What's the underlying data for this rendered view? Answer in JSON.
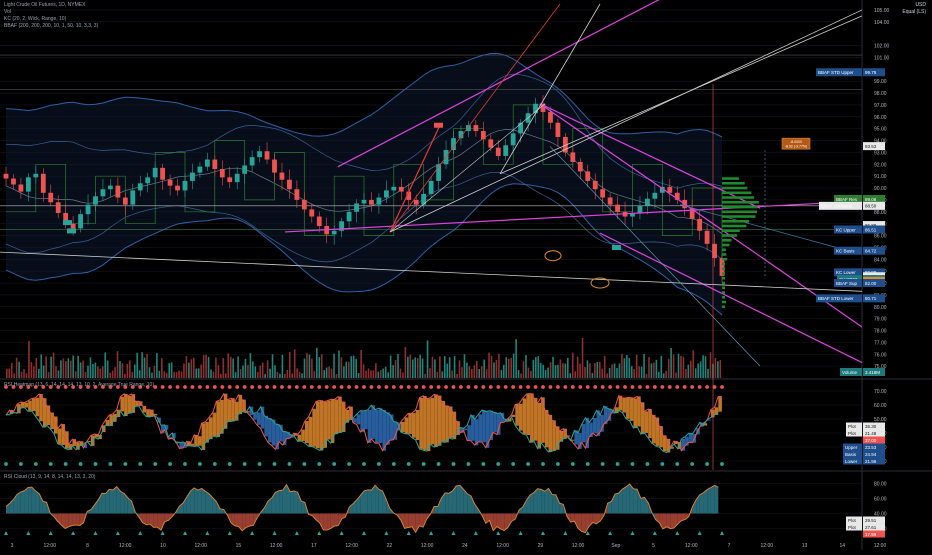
{
  "header": {
    "symbol_line": "Light Crude Oil Futures, 1D, NYMEX",
    "sub_line": "Vol",
    "ind1_line": "KC (20, 2, Wick, Range, 10)",
    "ind2_line": "BBAF (200, 200, 200, 10, 1, 50, 10, 3.3, 3)",
    "currency": "USD",
    "scale_mode": "Equal (LS)"
  },
  "colors": {
    "bg": "#000000",
    "up": "#26a69a",
    "down": "#ef5350",
    "magenta": "#e040e0",
    "white_line": "#d0d0d0",
    "blue_band": "#2f5fa8",
    "green_line": "#2e7d32",
    "orange": "#e08a2c",
    "cyan": "#29b6f6"
  },
  "main_axis": {
    "ticks": [
      "105.00",
      "104.00",
      "102.00",
      "101.00",
      "99.00",
      "98.00",
      "97.00",
      "96.00",
      "95.00",
      "94.00",
      "93.00",
      "92.00",
      "91.00",
      "90.00",
      "89.00",
      "88.00",
      "87.00",
      "86.00",
      "85.00",
      "84.00",
      "83.00",
      "82.00",
      "81.00",
      "80.00",
      "79.00",
      "78.00",
      "77.00",
      "76.00",
      "75.00",
      "74.00"
    ]
  },
  "price_labels": [
    {
      "text": "BBAF STD Upper",
      "value": "99.75",
      "bg": "#1e4e8c",
      "label_bg": "#1e4e8c"
    },
    {
      "text": "",
      "value": "93.53",
      "bg": "#e8e8e8",
      "label_bg": ""
    },
    {
      "text": "BBAF Res",
      "value": "89.08",
      "bg": "#2e7d32",
      "label_bg": "#2e7d32"
    },
    {
      "text": "BBAF 200basis",
      "value": "88.50",
      "bg": "#e8e8e8",
      "label_bg": "#e8e8e8"
    },
    {
      "text": "",
      "value": "86.88",
      "bg": "#e8e8e8",
      "label_bg": ""
    },
    {
      "text": "KC Upper",
      "value": "86.51",
      "bg": "#1e4e8c",
      "label_bg": "#1e4e8c"
    },
    {
      "text": "KC Basis",
      "value": "84.72",
      "bg": "#1e4e8c",
      "label_bg": "#1e4e8c"
    },
    {
      "text": "KC Lower",
      "value": "82.90",
      "bg": "#1e4e8c",
      "label_bg": "#1e4e8c"
    },
    {
      "text": "",
      "value": "82.57",
      "bg": "#e8e8e8",
      "label_bg": ""
    },
    {
      "text": "CLV2023",
      "value": "82.33",
      "bg": "#1e7a7a",
      "label_bg": "#1e7a7a"
    },
    {
      "text": "",
      "value": "82.18",
      "bg": "#e08a2c",
      "label_bg": ""
    },
    {
      "text": "BBAF Sup",
      "value": "82.00",
      "bg": "#1e4e8c",
      "label_bg": "#1e4e8c"
    },
    {
      "text": "BBAF STD Lower",
      "value": "80.71",
      "bg": "#1e4e8c",
      "label_bg": "#1e4e8c"
    },
    {
      "text": "Volume",
      "value": "3.418M",
      "bg": "#1e7a7a",
      "label_bg": "#1e7a7a"
    }
  ],
  "callout": {
    "line1": "-8.0000",
    "line2": "-8.92 (-9.77%)"
  },
  "ind1": {
    "legend": "RSI Heatmap (13, 6, 14, 14, 14, 13, 10, 2, Average True Range, 10)",
    "ticks": [
      "70.00",
      "60.00",
      "50.00",
      "40.00",
      "30.00",
      "20.00"
    ],
    "labels": [
      {
        "text": "Plot",
        "value": "36.30",
        "bg": "#e8e8e8"
      },
      {
        "text": "Plot",
        "value": "21.48",
        "bg": "#e8e8e8"
      },
      {
        "text": "",
        "value": "37.00",
        "bg": "#ef5350"
      },
      {
        "text": "Upper",
        "value": "23.53",
        "bg": "#1e4e8c"
      },
      {
        "text": "Basis",
        "value": "24.94",
        "bg": "#1e4e8c"
      },
      {
        "text": "Lower",
        "value": "21.96",
        "bg": "#1e4e8c"
      }
    ]
  },
  "ind2": {
    "legend": "RSI Cloud (13, 9, 14, 8, 14, 14, 13, 3, 20)",
    "ticks": [
      "80.00",
      "60.00",
      "40.00",
      "20.00"
    ],
    "labels": [
      {
        "text": "Plot",
        "value": "29.51",
        "bg": "#e8e8e8"
      },
      {
        "text": "Plot",
        "value": "27.61",
        "bg": "#e8e8e8"
      },
      {
        "text": "",
        "value": "17.99",
        "bg": "#ef5350"
      }
    ]
  },
  "time_axis": {
    "ticks": [
      "3",
      "12:00",
      "8",
      "12:00",
      "10",
      "12:00",
      "15",
      "12:00",
      "17",
      "12:00",
      "22",
      "12:00",
      "24",
      "12:00",
      "29",
      "12:00",
      "Sep",
      "5",
      "12:00",
      "7",
      "12:00",
      "13",
      "14",
      "12:00"
    ]
  },
  "chart_data": {
    "type": "candlestick",
    "title": "Light Crude Oil Futures, 1D, NYMEX",
    "xlabel": "",
    "ylabel": "",
    "ylim": [
      74,
      105.5
    ],
    "closes": [
      90.8,
      90.3,
      89.7,
      90.9,
      91.2,
      89.6,
      88.8,
      87.9,
      87.0,
      86.6,
      87.8,
      88.6,
      89.3,
      89.9,
      90.2,
      89.2,
      88.6,
      89.8,
      90.4,
      90.9,
      91.7,
      90.7,
      90.2,
      89.8,
      90.6,
      91.3,
      91.8,
      92.4,
      91.6,
      90.9,
      90.5,
      91.2,
      91.9,
      92.6,
      93.1,
      92.4,
      91.3,
      90.7,
      89.9,
      89.0,
      88.2,
      87.6,
      86.8,
      86.1,
      86.4,
      87.2,
      88.0,
      88.7,
      89.0,
      88.6,
      89.2,
      89.8,
      90.1,
      89.7,
      89.0,
      88.6,
      89.5,
      90.6,
      92.0,
      93.2,
      94.2,
      94.8,
      95.3,
      94.8,
      94.1,
      93.4,
      92.7,
      93.6,
      94.6,
      95.5,
      96.3,
      97.1,
      96.4,
      95.5,
      94.3,
      93.0,
      92.2,
      91.4,
      90.6,
      89.9,
      89.2,
      88.6,
      88.0,
      87.6,
      87.9,
      88.5,
      89.1,
      89.6,
      90.1,
      89.6,
      89.0,
      88.3,
      87.4,
      86.4,
      85.3,
      84.1,
      82.6
    ],
    "last_price": "82.57"
  }
}
